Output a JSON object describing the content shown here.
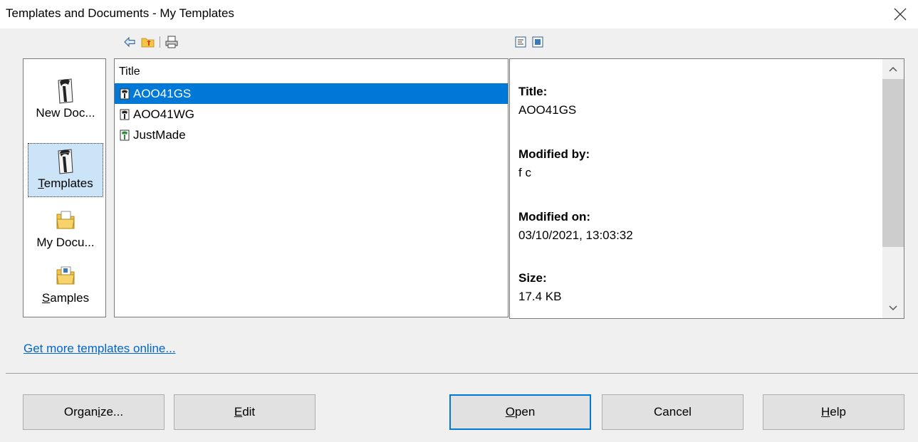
{
  "window": {
    "title": "Templates and Documents - My Templates"
  },
  "places": [
    {
      "label": "New Doc...",
      "mnemonic_pre": "New Doc...",
      "mnemonic_char": "",
      "mnemonic_post": "",
      "icon": "new-document-icon",
      "selected": false
    },
    {
      "label": "Templates",
      "mnemonic_pre": "",
      "mnemonic_char": "T",
      "mnemonic_post": "emplates",
      "icon": "templates-icon",
      "selected": true
    },
    {
      "label": "My Docu...",
      "mnemonic_pre": "My Docu...",
      "mnemonic_char": "",
      "mnemonic_post": "",
      "icon": "my-documents-folder-icon",
      "selected": false
    },
    {
      "label": "Samples",
      "mnemonic_pre": "",
      "mnemonic_char": "S",
      "mnemonic_post": "amples",
      "icon": "samples-folder-icon",
      "selected": false
    }
  ],
  "filelist": {
    "column_title": "Title",
    "rows": [
      {
        "name": "AOO41GS",
        "selected": true
      },
      {
        "name": "AOO41WG",
        "selected": false
      },
      {
        "name": "JustMade",
        "selected": false
      }
    ]
  },
  "preview": {
    "title_label": "Title:",
    "title_value": "AOO41GS",
    "modified_by_label": "Modified by:",
    "modified_by_value": "f c",
    "modified_on_label": "Modified on:",
    "modified_on_value": "03/10/2021, 13:03:32",
    "size_label": "Size:",
    "size_value": "17.4 KB"
  },
  "link": {
    "text": "Get more templates online..."
  },
  "buttons": {
    "organize": {
      "pre": "Organ",
      "char": "i",
      "post": "ze..."
    },
    "edit": {
      "pre": "",
      "char": "E",
      "post": "dit"
    },
    "open": {
      "pre": "",
      "char": "O",
      "post": "pen"
    },
    "cancel": {
      "pre": "Cancel",
      "char": "",
      "post": ""
    },
    "help": {
      "pre": "",
      "char": "H",
      "post": "elp"
    }
  },
  "colors": {
    "selection": "#0078d7",
    "place_selected": "#cce4f7",
    "link": "#0066cc"
  }
}
